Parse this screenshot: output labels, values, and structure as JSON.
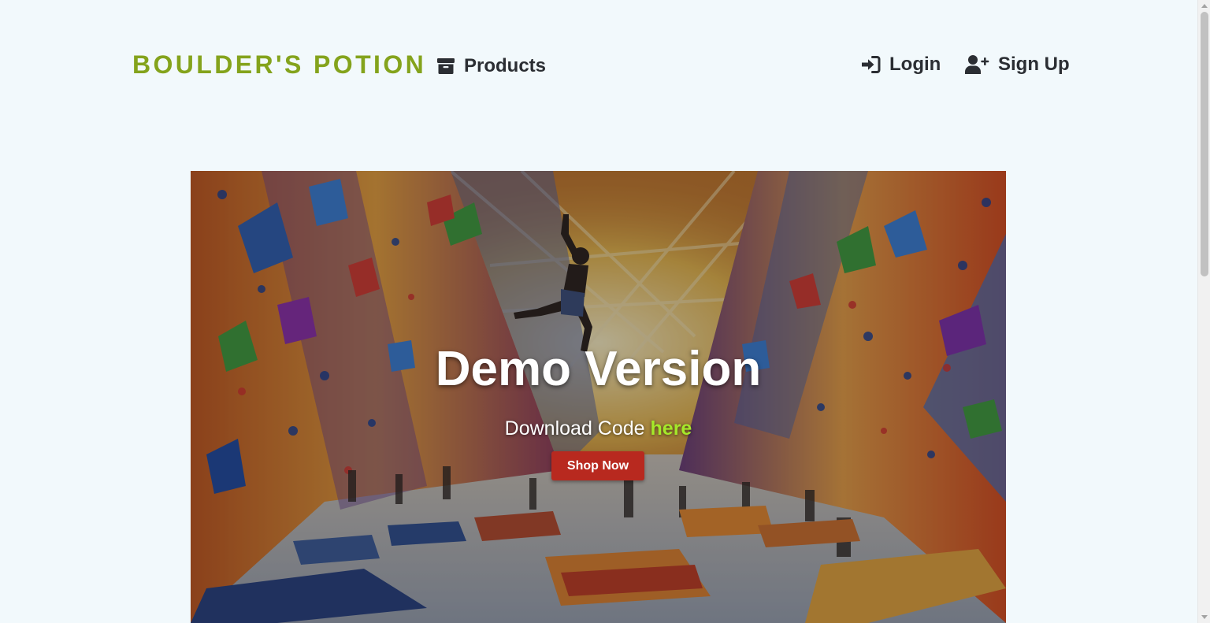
{
  "header": {
    "brand": "BOULDER'S POTION",
    "nav": {
      "products_label": "Products",
      "products_icon": "archive-box-icon",
      "login_label": "Login",
      "login_icon": "sign-in-icon",
      "signup_label": "Sign Up",
      "signup_icon": "user-plus-icon"
    }
  },
  "hero": {
    "image": "painting of climbers in an indoor bouldering gym",
    "title": "Demo Version",
    "subtitle_prefix": "Download Code ",
    "subtitle_link": "here",
    "cta_label": "Shop Now"
  },
  "colors": {
    "page_background": "#f2f9fc",
    "brand": "#84a31c",
    "nav_text": "#2b2e33",
    "link_accent": "#a5e82a",
    "cta_background": "#b8291f",
    "cta_text": "#ffffff"
  }
}
